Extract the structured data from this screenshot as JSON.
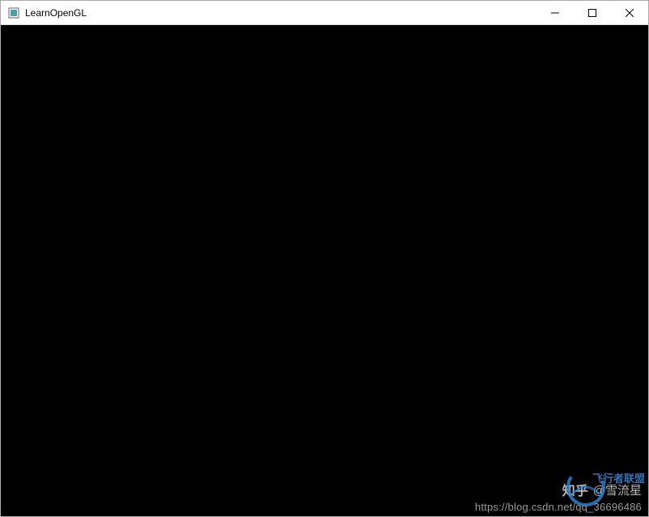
{
  "window": {
    "title": "LearnOpenGL"
  },
  "watermark": {
    "zhihu_label": "知乎",
    "zhihu_handle": "@雪流星",
    "extra_text": "飞行者联盟",
    "url": "https://blog.csdn.net/qq_36696486"
  }
}
